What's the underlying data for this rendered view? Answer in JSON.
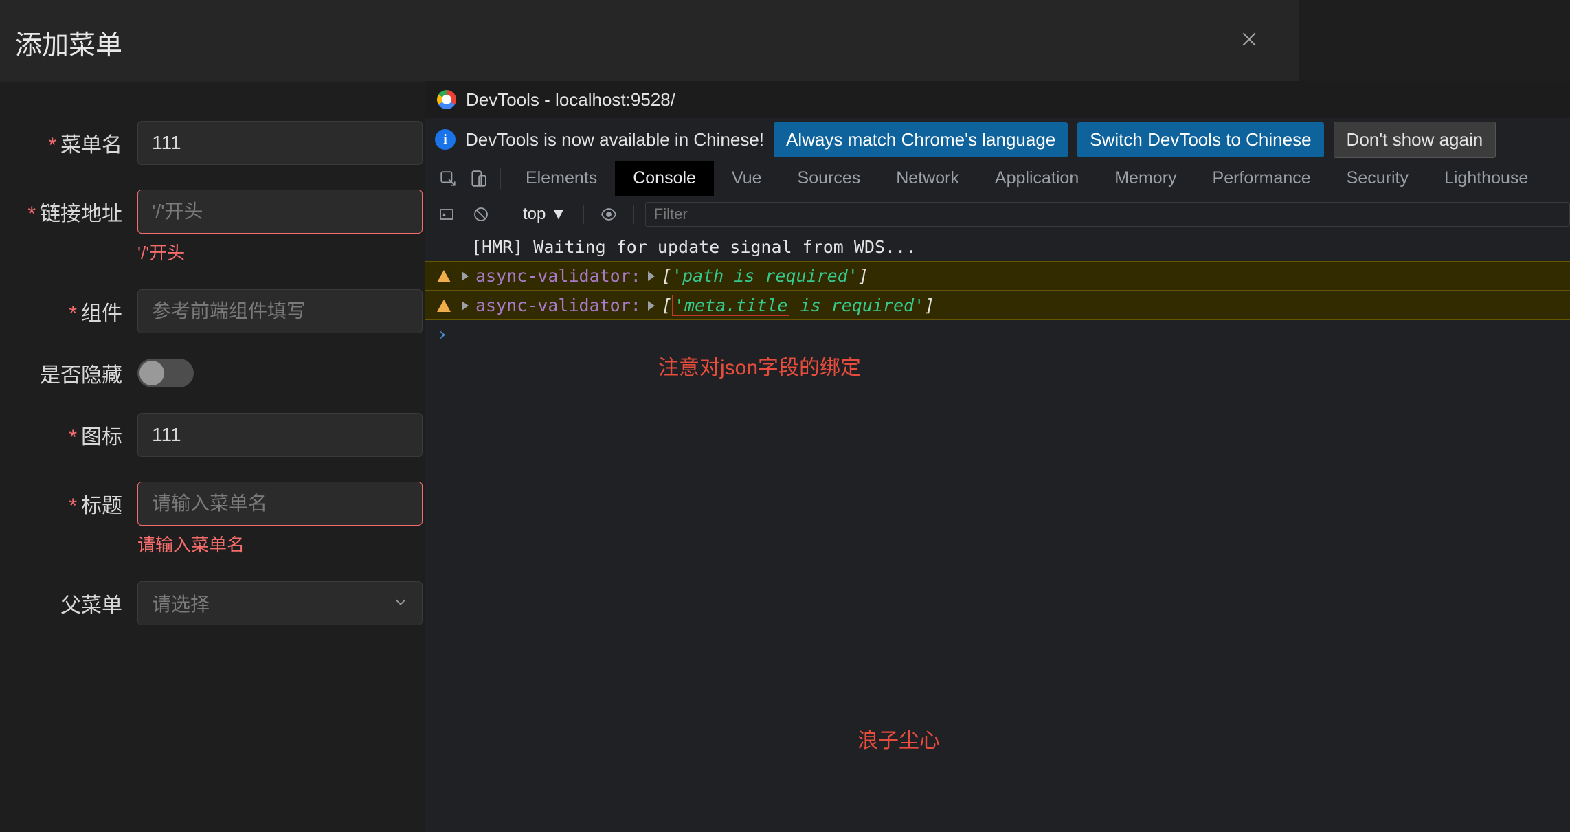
{
  "dialog": {
    "title": "添加菜单"
  },
  "form": {
    "menuName": {
      "label": "菜单名",
      "value": "111"
    },
    "linkPath": {
      "label": "链接地址",
      "placeholder": "'/'开头",
      "error": "'/'开头"
    },
    "component": {
      "label": "组件",
      "placeholder": "参考前端组件填写"
    },
    "hidden": {
      "label": "是否隐藏"
    },
    "icon": {
      "label": "图标",
      "value": "111"
    },
    "title": {
      "label": "标题",
      "placeholder": "请输入菜单名",
      "error": "请输入菜单名"
    },
    "parent": {
      "label": "父菜单",
      "placeholder": "请选择"
    }
  },
  "devtools": {
    "title": "DevTools - localhost:9528/",
    "infobar": {
      "text": "DevTools is now available in Chinese!",
      "btnAlways": "Always match Chrome's language",
      "btnSwitch": "Switch DevTools to Chinese",
      "btnDismiss": "Don't show again"
    },
    "tabs": [
      "Elements",
      "Console",
      "Vue",
      "Sources",
      "Network",
      "Application",
      "Memory",
      "Performance",
      "Security",
      "Lighthouse"
    ],
    "activeTab": "Console",
    "toolbar": {
      "context": "top ▼",
      "filterPlaceholder": "Filter"
    },
    "console": {
      "line0": "[HMR] Waiting for update signal from WDS...",
      "warn1": {
        "label": "async-validator:",
        "open": "[",
        "str": "'path is required'",
        "close": "]"
      },
      "warn2": {
        "label": "async-validator:",
        "open": "[",
        "strA": "'meta.title",
        "strB": " is required'",
        "close": "]"
      }
    }
  },
  "annotations": {
    "a1": "注意对json字段的绑定",
    "a2": "浪子尘心"
  }
}
